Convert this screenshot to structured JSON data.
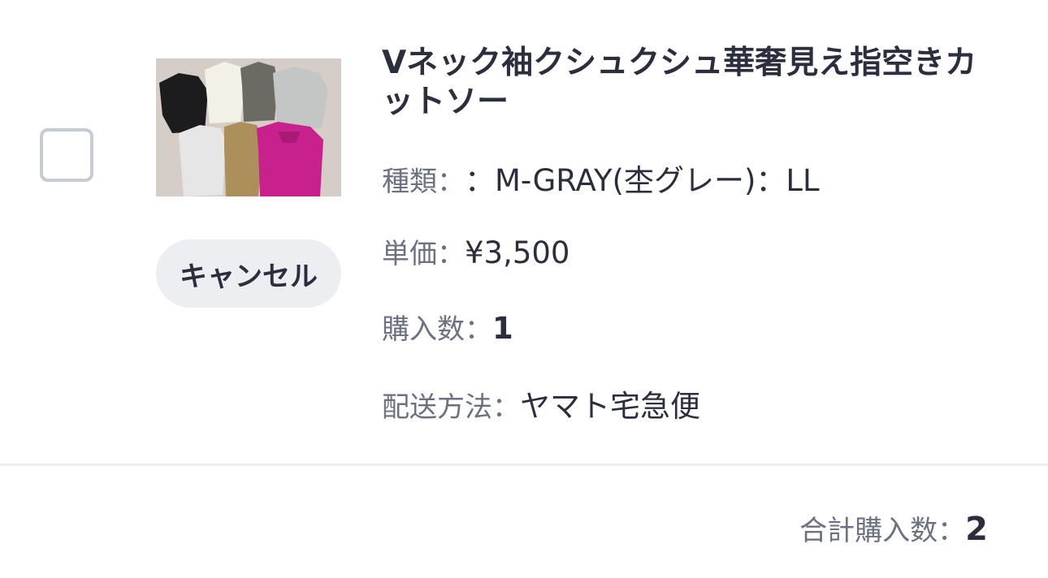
{
  "item": {
    "title": "Vネック袖クシュクシュ華奢見え指空きカットソー",
    "image_alt": "product-photo-folded-shirts",
    "cancel_label": "キャンセル",
    "kind_label": "種類：",
    "kind_value": "：M-GRAY(杢グレー)：LL",
    "price_label": "単価：",
    "price_value": "¥3,500",
    "qty_label": "購入数：",
    "qty_value": "1",
    "shipping_label": "配送方法：",
    "shipping_value": "ヤマト宅急便",
    "checked": false
  },
  "summary": {
    "total_label": "合計購入数：",
    "total_value": "2"
  },
  "colors": {
    "text": "#2b2f3d",
    "muted": "#6b7180",
    "button_bg": "#eceef2",
    "checkbox_border": "#c5ccd4",
    "divider": "#eceef1"
  }
}
